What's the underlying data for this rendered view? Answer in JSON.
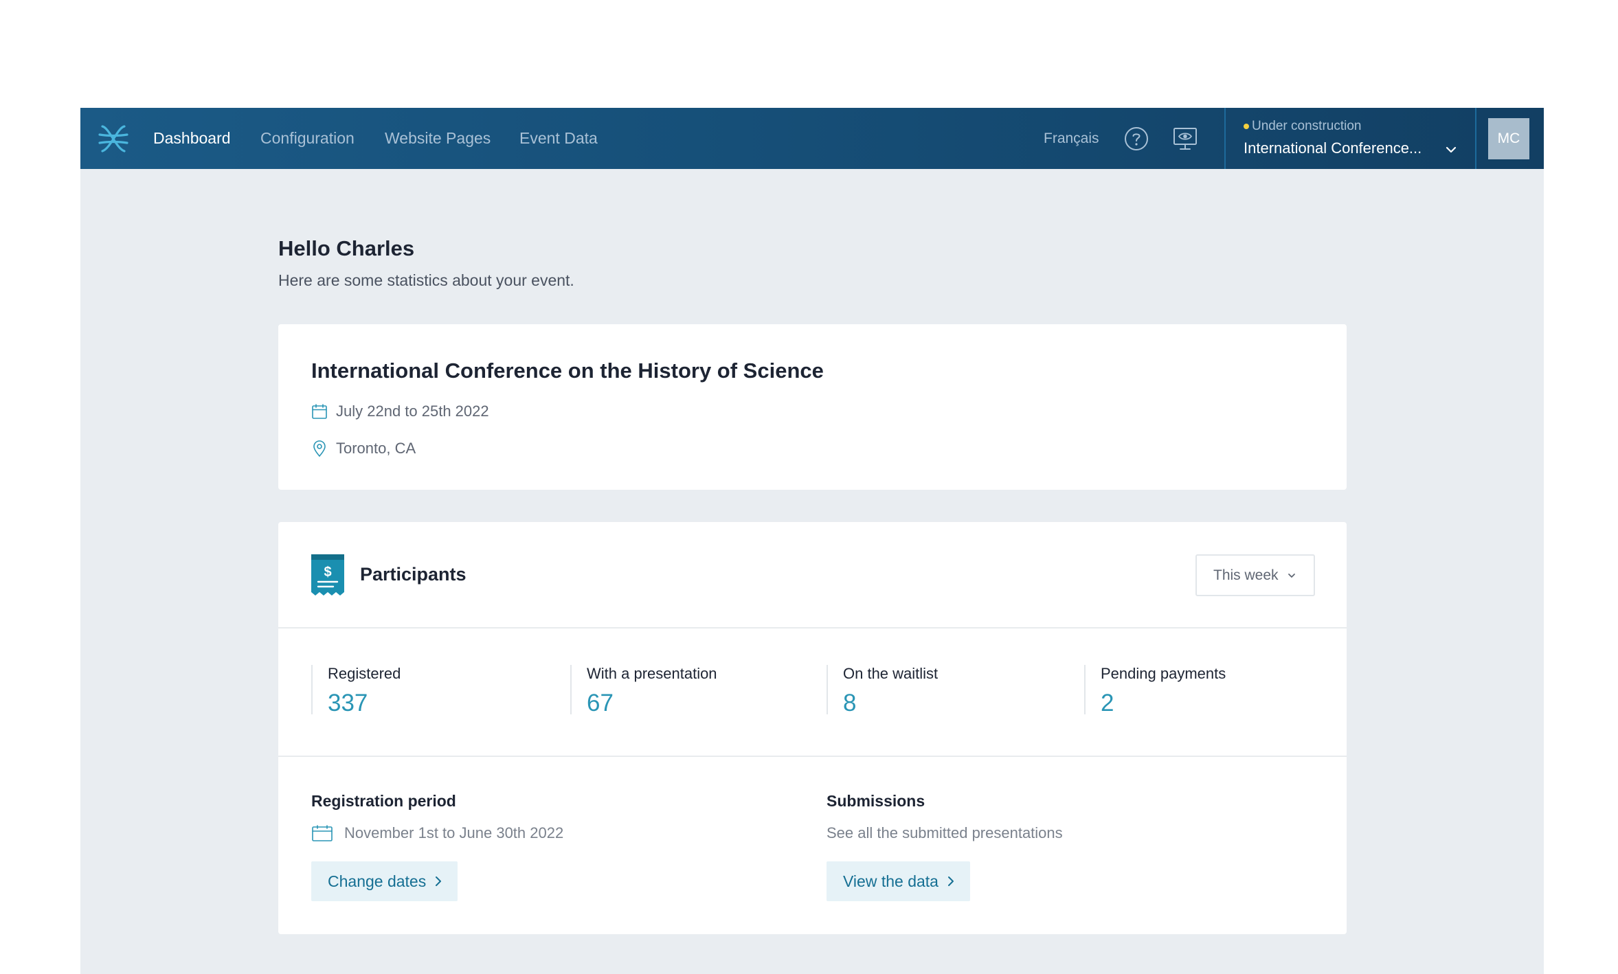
{
  "nav": {
    "items": [
      {
        "label": "Dashboard",
        "active": true
      },
      {
        "label": "Configuration",
        "active": false
      },
      {
        "label": "Website Pages",
        "active": false
      },
      {
        "label": "Event Data",
        "active": false
      }
    ],
    "language": "Français",
    "help_icon": "question-circle-icon",
    "preview_icon": "monitor-eye-icon"
  },
  "event_switcher": {
    "status": "Under construction",
    "status_color": "#f4d03f",
    "event_name": "International Conference..."
  },
  "user": {
    "initials": "MC"
  },
  "greeting": {
    "title": "Hello Charles",
    "subtitle": "Here are some statistics about your event."
  },
  "event_card": {
    "title": "International Conference on the History of Science",
    "dates": "July 22nd to 25th 2022",
    "location": "Toronto, CA"
  },
  "participants": {
    "title": "Participants",
    "period": "This week",
    "stats": [
      {
        "label": "Registered",
        "value": "337"
      },
      {
        "label": "With a presentation",
        "value": "67"
      },
      {
        "label": "On the waitlist",
        "value": "8"
      },
      {
        "label": "Pending payments",
        "value": "2"
      }
    ],
    "registration": {
      "title": "Registration period",
      "dates": "November 1st to June 30th 2022",
      "button": "Change dates"
    },
    "submissions": {
      "title": "Submissions",
      "text": "See all the submitted presentations",
      "button": "View the data"
    }
  },
  "colors": {
    "accent": "#2a95b5",
    "nav_bg": "#164f78",
    "page_bg": "#e9edf1"
  }
}
